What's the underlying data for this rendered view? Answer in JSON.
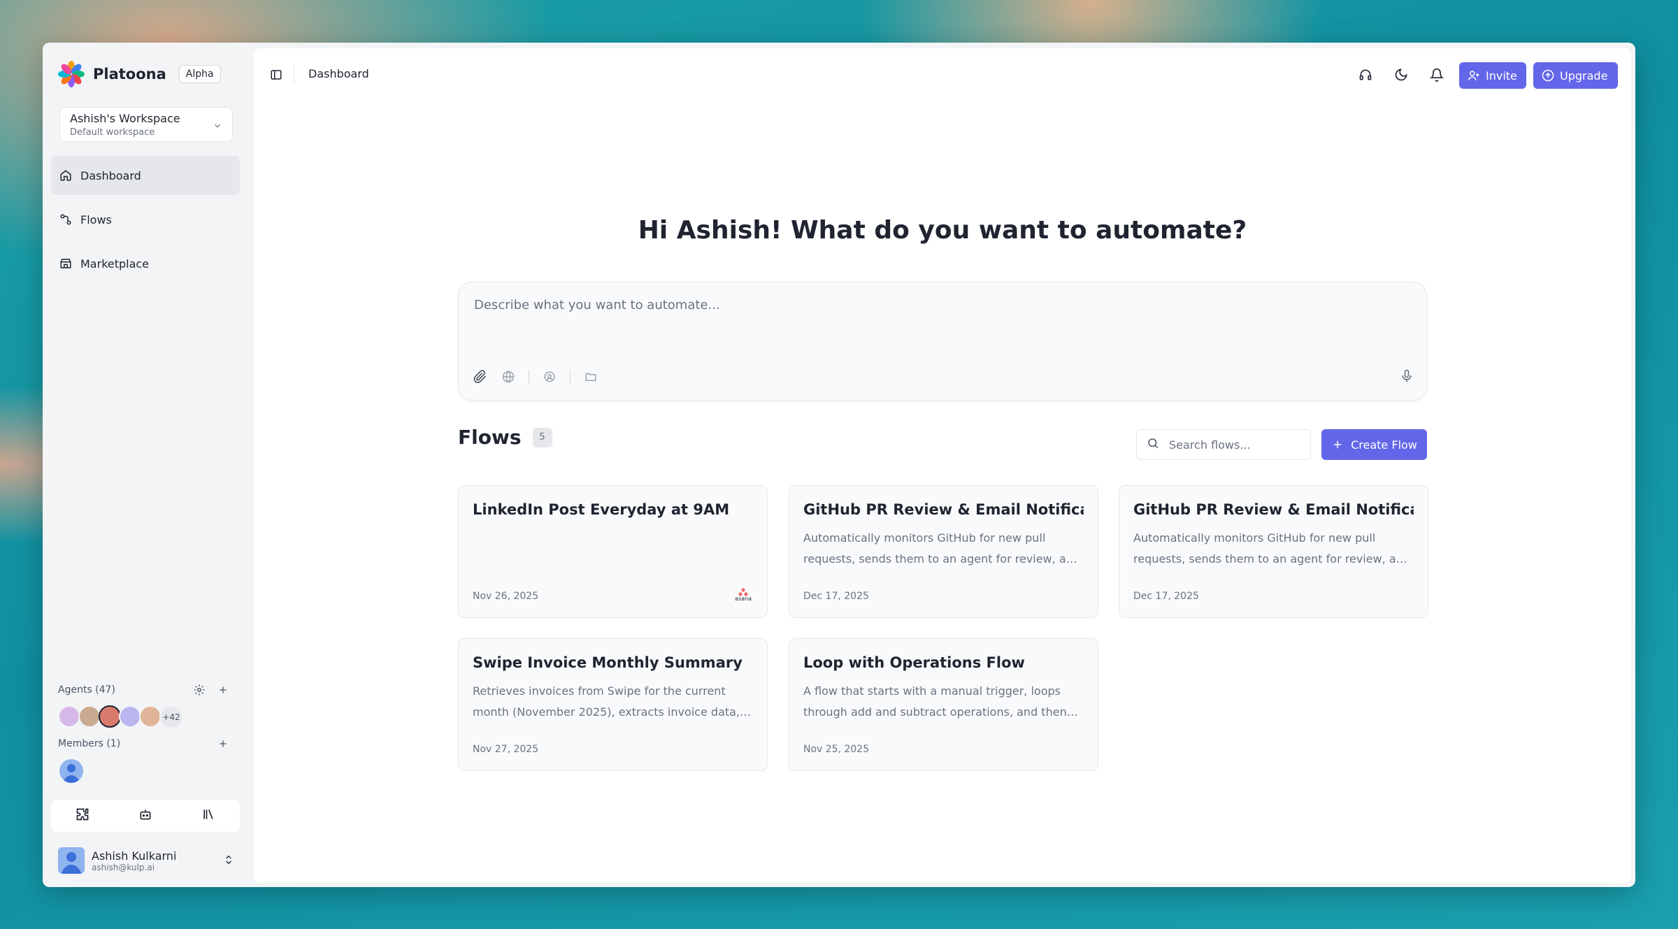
{
  "brand": {
    "name": "Platoona",
    "badge": "Alpha"
  },
  "workspace": {
    "name": "Ashish's Workspace",
    "subtitle": "Default workspace"
  },
  "nav": [
    {
      "label": "Dashboard",
      "icon": "home-icon",
      "active": true
    },
    {
      "label": "Flows",
      "icon": "flows-icon",
      "active": false
    },
    {
      "label": "Marketplace",
      "icon": "store-icon",
      "active": false
    }
  ],
  "agents": {
    "title": "Agents (47)",
    "more": "+42"
  },
  "members": {
    "title": "Members (1)"
  },
  "user": {
    "name": "Ashish Kulkarni",
    "email": "ashish@kulp.ai"
  },
  "topbar": {
    "breadcrumb": "Dashboard",
    "invite_label": "Invite",
    "upgrade_label": "Upgrade"
  },
  "hero": {
    "title": "Hi Ashish! What do you want to automate?"
  },
  "prompt": {
    "placeholder": "Describe what you want to automate..."
  },
  "flows": {
    "title": "Flows",
    "count": "5",
    "search_placeholder": "Search flows...",
    "create_label": "Create Flow",
    "cards": [
      {
        "title": "LinkedIn Post Everyday at 9AM",
        "description": "",
        "date": "Nov 26, 2025",
        "logo": "asana"
      },
      {
        "title": "GitHub PR Review & Email Notification",
        "description": "Automatically monitors GitHub for new pull requests, sends them to an agent for review, and sends an email notification",
        "date": "Dec 17, 2025",
        "logo": ""
      },
      {
        "title": "GitHub PR Review & Email Notification",
        "description": "Automatically monitors GitHub for new pull requests, sends them to an agent for review, and sends an email notification",
        "date": "Dec 17, 2025",
        "logo": ""
      },
      {
        "title": "Swipe Invoice Monthly Summary",
        "description": "Retrieves invoices from Swipe for the current month (November 2025), extracts invoice data, and summarizes",
        "date": "Nov 27, 2025",
        "logo": ""
      },
      {
        "title": "Loop with Operations Flow",
        "description": "A flow that starts with a manual trigger, loops through add and subtract operations, and then handles the result",
        "date": "Nov 25, 2025",
        "logo": ""
      }
    ]
  },
  "colors": {
    "accent": "#6366e8",
    "background": "#f3f4f6"
  }
}
